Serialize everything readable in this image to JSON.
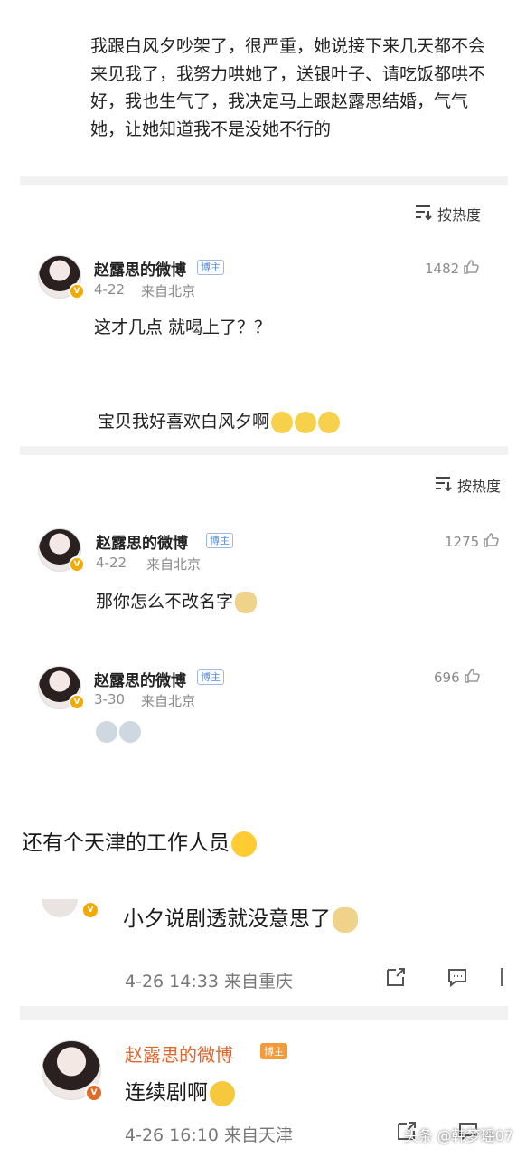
{
  "post": {
    "text": "我跟白风夕吵架了，很严重，她说接下来几天都不会来见我了，我努力哄她了，送银叶子、请吃饭都哄不好，我也生气了，我决定马上跟赵露思结婚，气气她，让她知道我不是没她不行的"
  },
  "sort_label": "按热度",
  "comments": [
    {
      "user": "赵露思的微博",
      "badge": "博主",
      "date": "4-22",
      "location": "来自北京",
      "likes": "1482",
      "text": "这才几点 就喝上了？？"
    },
    {
      "text": "宝贝我好喜欢白风夕啊"
    },
    {
      "user": "赵露思的微博",
      "badge": "博主",
      "date": "4-22",
      "location": "来自北京",
      "likes": "1275",
      "text": "那你怎么不改名字"
    },
    {
      "user": "赵露思的微博",
      "badge": "博主",
      "date": "3-30",
      "location": "来自北京",
      "likes": "696"
    }
  ],
  "caption": "还有个天津的工作人员",
  "reply1": {
    "text": "小夕说剧透就没意思了",
    "meta": "4-26 14:33 来自重庆"
  },
  "reply2": {
    "user": "赵露思的微博",
    "badge": "博主",
    "text": "连续剧啊",
    "meta": "4-26 16:10 来自天津"
  },
  "watermark": "头条 @韩梦瑶07"
}
